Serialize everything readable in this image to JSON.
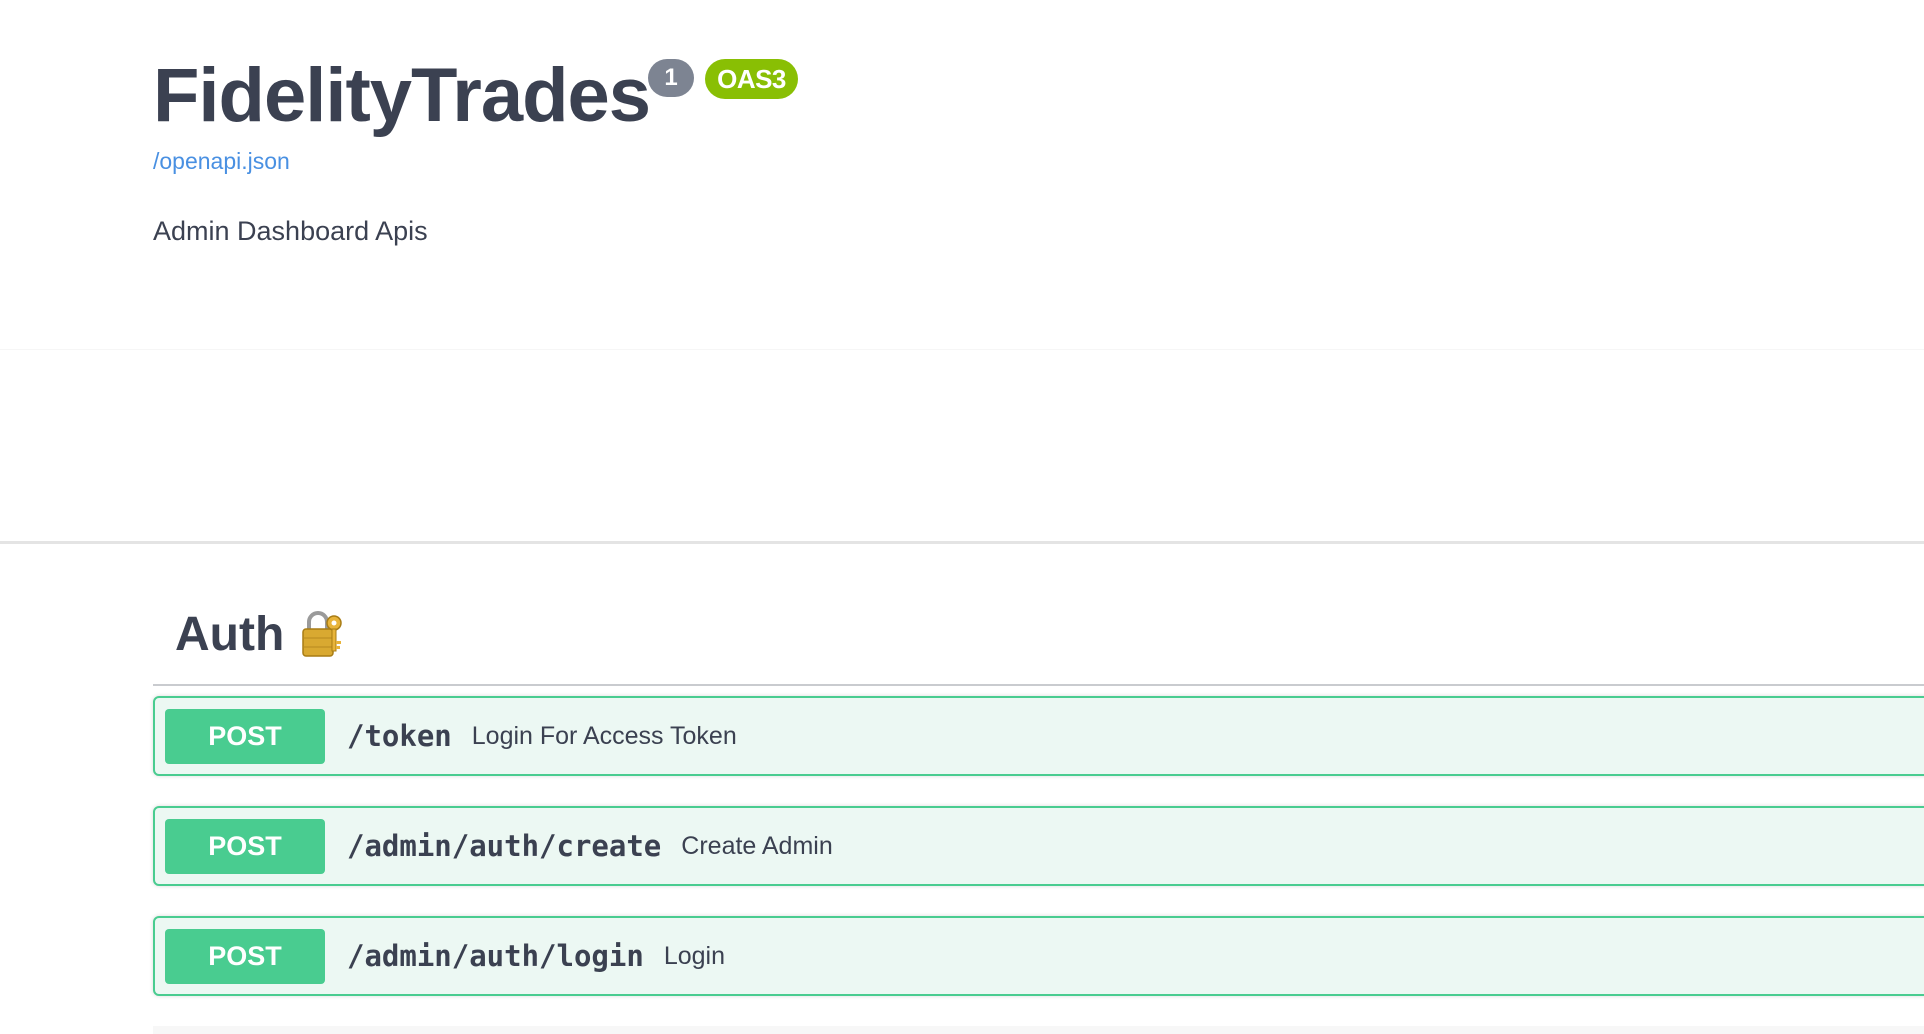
{
  "info": {
    "title": "FidelityTrades",
    "version_badge": "1",
    "oas_badge": "OAS3",
    "spec_link": "/openapi.json",
    "description": "Admin Dashboard Apis"
  },
  "tag": {
    "name": "Auth",
    "icon": "locked-with-key-icon"
  },
  "operations": [
    {
      "method": "POST",
      "path": "/token",
      "summary": "Login For Access Token"
    },
    {
      "method": "POST",
      "path": "/admin/auth/create",
      "summary": "Create Admin"
    },
    {
      "method": "POST",
      "path": "/admin/auth/login",
      "summary": "Login"
    }
  ],
  "colors": {
    "post": "#49cc90",
    "post_bg": "#ecf8f3",
    "link": "#4990e2",
    "oas_badge": "#89bf04",
    "version_badge": "#7d8492",
    "text": "#3b4151"
  }
}
